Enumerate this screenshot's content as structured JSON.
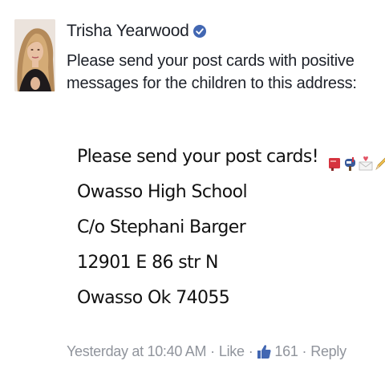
{
  "comment": {
    "author": "Trisha Yearwood",
    "verified": true,
    "text_lines": [
      "Please send your post cards with  positive",
      "messages for the children to this address:"
    ],
    "attachment_lines": [
      "Please send your post cards!",
      "Owasso High School",
      "C/o Stephani Barger",
      "12901 E 86 str N",
      "Owasso Ok 74055"
    ],
    "emoji_icons": [
      "postcard-icon",
      "mailbox-icon",
      "envelope-heart-icon",
      "pencil-icon"
    ]
  },
  "meta": {
    "timestamp": "Yesterday at 10:40 AM",
    "like_label": "Like",
    "like_count": "161",
    "reply_label": "Reply"
  },
  "colors": {
    "text": "#1d2129",
    "meta": "#90949c",
    "verified": "#4267b2",
    "like_blue": "#4267b2"
  }
}
